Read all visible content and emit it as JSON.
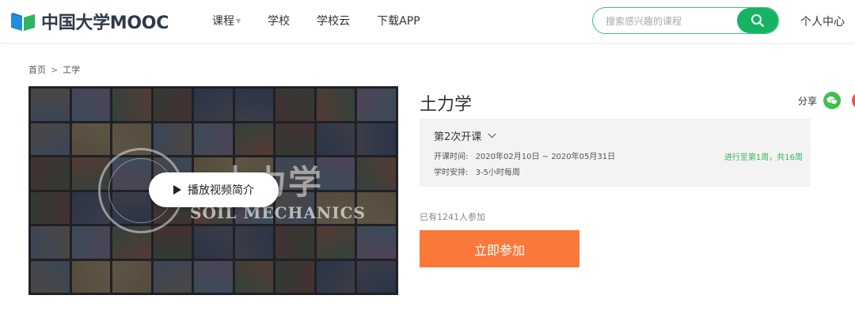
{
  "header": {
    "logo_text": "中国大学MOOC",
    "nav": [
      {
        "label": "课程",
        "has_caret": true
      },
      {
        "label": "学校"
      },
      {
        "label": "学校云"
      },
      {
        "label": "下载APP"
      }
    ],
    "search": {
      "placeholder": "搜索感兴趣的课程",
      "icon": "search-icon"
    },
    "user_center": "个人中心"
  },
  "breadcrumb": [
    "首页",
    "工学"
  ],
  "breadcrumb_sep": ">",
  "video": {
    "play_label": "播放视频简介",
    "overlay_title": "土力学",
    "overlay_subtitle": "SOIL MECHANICS"
  },
  "course": {
    "title": "土力学",
    "share_label": "分享",
    "term": "第2次开课",
    "open_time_label": "开课时间:",
    "open_time_value": "2020年02月10日 ~ 2020年05月31日",
    "study_label": "学时安排:",
    "study_value": "3-5小时每周",
    "progress": "进行至第1周，共16周",
    "joined": "已有1241人参加",
    "join_button": "立即参加"
  },
  "colors": {
    "brand_green": "#16b364",
    "join_orange": "#f9783a",
    "progress_green": "#35b558"
  }
}
